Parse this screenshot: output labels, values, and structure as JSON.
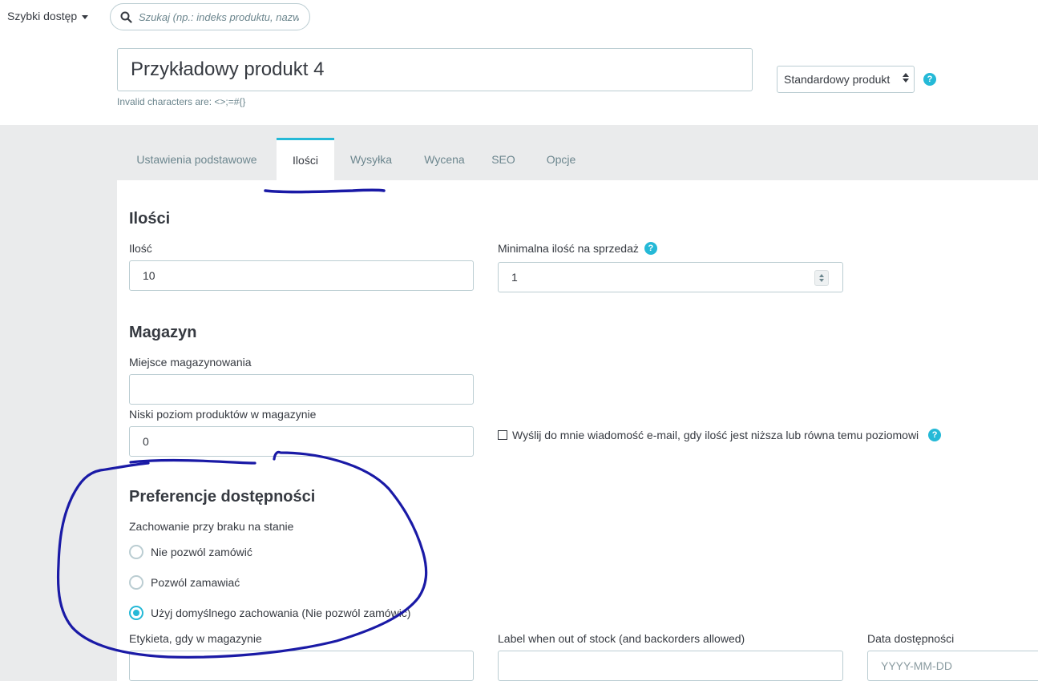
{
  "topbar": {
    "quick_access_label": "Szybki dostęp",
    "search_placeholder": "Szukaj (np.: indeks produktu, nazwa k"
  },
  "product": {
    "name_value": "Przykładowy produkt 4",
    "invalid_note": "Invalid characters are: <>;=#{}",
    "type_selected": "Standardowy produkt",
    "help_glyph": "?"
  },
  "tabs": [
    {
      "label": "Ustawienia podstawowe",
      "active": false
    },
    {
      "label": "Ilości",
      "active": true
    },
    {
      "label": "Wysyłka",
      "active": false
    },
    {
      "label": "Wycena",
      "active": false
    },
    {
      "label": "SEO",
      "active": false
    },
    {
      "label": "Opcje",
      "active": false
    }
  ],
  "quantities": {
    "heading": "Ilości",
    "quantity_label": "Ilość",
    "quantity_value": "10",
    "min_qty_label": "Minimalna ilość na sprzedaż",
    "min_qty_value": "1"
  },
  "stock": {
    "heading": "Magazyn",
    "location_label": "Miejsce magazynowania",
    "location_value": "",
    "low_stock_label": "Niski poziom produktów w magazynie",
    "low_stock_value": "0",
    "email_alert_label": "Wyślij do mnie wiadomość e-mail, gdy ilość jest niższa lub równa temu poziomowi",
    "email_alert_checked": false
  },
  "availability": {
    "heading": "Preferencje dostępności",
    "behavior_label": "Zachowanie przy braku na stanie",
    "options": [
      {
        "label": "Nie pozwól zamówić",
        "checked": false
      },
      {
        "label": "Pozwól zamawiać",
        "checked": false
      },
      {
        "label": "Użyj domyślnego zachowania (Nie pozwól zamówić)",
        "checked": true
      }
    ],
    "in_stock_label": "Etykieta, gdy w magazynie",
    "out_of_stock_label": "Label when out of stock (and backorders allowed)",
    "availability_date_label": "Data dostępności",
    "availability_date_placeholder": "YYYY-MM-DD"
  },
  "colors": {
    "accent": "#25b9d7",
    "annotation_ink": "#1a1aa6"
  }
}
